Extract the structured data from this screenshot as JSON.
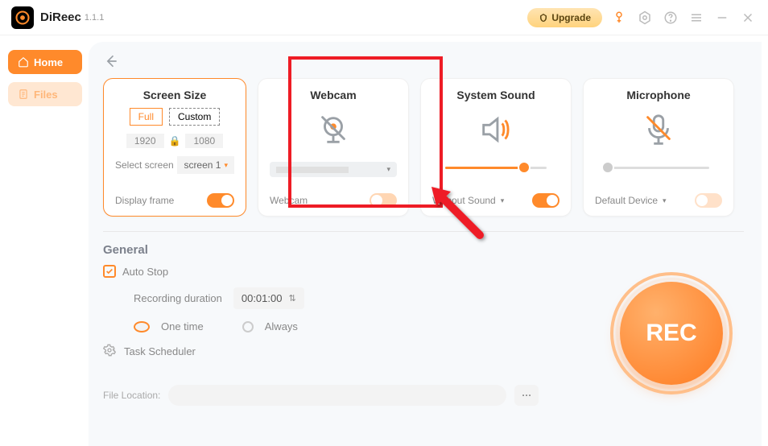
{
  "app": {
    "name": "DiReec",
    "version": "1.1.1"
  },
  "header": {
    "upgrade": "Upgrade"
  },
  "sidebar": {
    "items": [
      {
        "label": "Home",
        "active": true
      },
      {
        "label": "Files",
        "active": false
      }
    ]
  },
  "cards": {
    "screen": {
      "title": "Screen Size",
      "full": "Full",
      "custom": "Custom",
      "width": "1920",
      "height": "1080",
      "selectLabel": "Select screen",
      "selectValue": "screen 1",
      "displayFrame": "Display frame"
    },
    "webcam": {
      "title": "Webcam",
      "label": "Webcam"
    },
    "sound": {
      "title": "System Sound",
      "mode": "Without Sound",
      "sliderPercent": 78
    },
    "mic": {
      "title": "Microphone",
      "device": "Default Device",
      "sliderPercent": 0
    }
  },
  "general": {
    "title": "General",
    "autoStop": "Auto Stop",
    "recDurationLabel": "Recording duration",
    "recDurationValue": "00:01:00",
    "oneTime": "One time",
    "always": "Always",
    "taskScheduler": "Task Scheduler",
    "fileLocation": "File Location:"
  },
  "rec": {
    "label": "REC"
  }
}
